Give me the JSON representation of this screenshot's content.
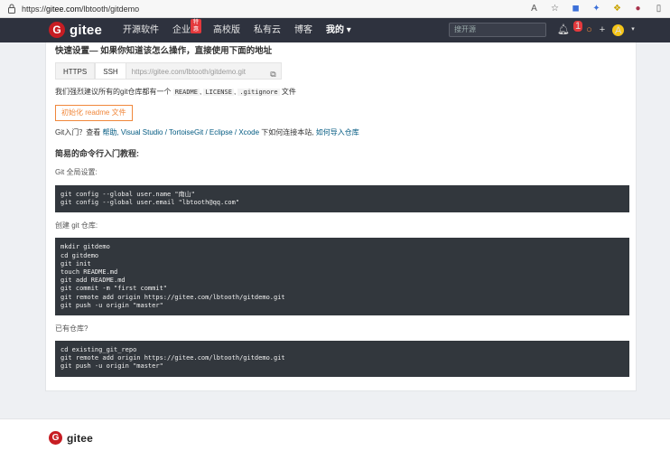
{
  "browser": {
    "url_prefix": "https://",
    "url_host": "gitee.com",
    "url_path": "/lbtooth/gitdemo",
    "icons": [
      "read-aloud-icon",
      "favorite-star-icon",
      "translate-icon",
      "extension-icon",
      "puzzle-icon",
      "profile-icon",
      "battery-icon"
    ]
  },
  "nav": {
    "logo_mark": "G",
    "logo_text": "gitee",
    "items": [
      {
        "label": "开源软件"
      },
      {
        "label": "企业版",
        "badge": "特惠"
      },
      {
        "label": "高校版"
      },
      {
        "label": "私有云"
      },
      {
        "label": "博客"
      },
      {
        "label": "我的 ▾"
      }
    ],
    "search_placeholder": "搜开源",
    "notif_count": "1",
    "avatar_letter": "A"
  },
  "quick_setup": {
    "title": "快速设置— 如果你知道该怎么操作，直接使用下面的地址",
    "tab_https": "HTTPS",
    "tab_ssh": "SSH",
    "repo_url": "https://gitee.com/lbtooth/gitdemo.git",
    "rec_text_1": "我们强烈建议所有的git仓库都有一个",
    "rec_code_1": "README",
    "rec_sep_1": ",",
    "rec_code_2": "LICENSE",
    "rec_sep_2": ",",
    "rec_code_3": ".gitignore",
    "rec_text_2": "文件",
    "init_button": "初始化 readme 文件",
    "git_intro_prefix": "Git入门？查看",
    "git_intro_help": "帮助",
    "git_intro_tools": ", Visual Studio / TortoiseGit / Eclipse / Xcode",
    "git_intro_mid": "下如何连接本站,",
    "git_intro_import": "如何导入仓库"
  },
  "tutorial": {
    "title": "简易的命令行入门教程:",
    "global_label": "Git 全局设置:",
    "global_code": "git config --global user.name \"南山\"\ngit config --global user.email \"lbtooth@qq.com\"",
    "create_label": "创建 git 仓库:",
    "create_code": "mkdir gitdemo\ncd gitdemo\ngit init\ntouch README.md\ngit add README.md\ngit commit -m \"first commit\"\ngit remote add origin https://gitee.com/lbtooth/gitdemo.git\ngit push -u origin \"master\"",
    "existing_label": "已有仓库?",
    "existing_code": "cd existing_git_repo\ngit remote add origin https://gitee.com/lbtooth/gitdemo.git\ngit push -u origin \"master\""
  },
  "footer": {
    "logo_mark": "G",
    "logo_text": "gitee"
  }
}
